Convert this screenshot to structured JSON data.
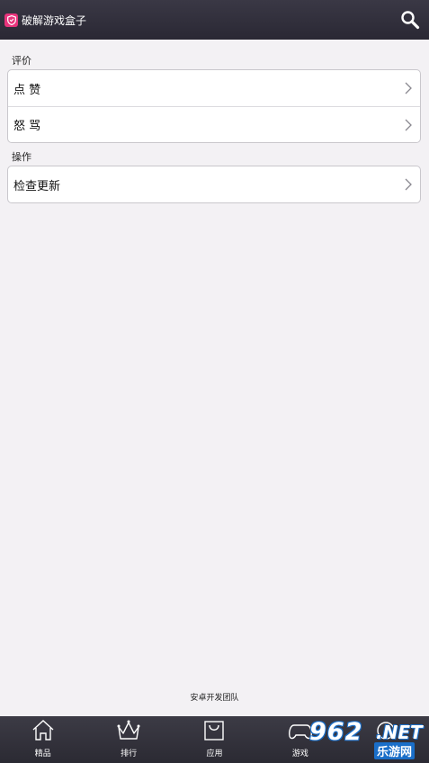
{
  "header": {
    "title": "破解游戏盒子",
    "search_icon": "search-icon",
    "app_icon": "shield-icon"
  },
  "sections": [
    {
      "label": "评价",
      "items": [
        {
          "label": "点 赞"
        },
        {
          "label": "怒 骂"
        }
      ]
    },
    {
      "label": "操作",
      "items": [
        {
          "label": "检查更新"
        }
      ]
    }
  ],
  "footer": {
    "text": "安卓开发团队"
  },
  "bottom_nav": {
    "items": [
      {
        "label": "精品",
        "icon": "home-icon"
      },
      {
        "label": "排行",
        "icon": "crown-icon"
      },
      {
        "label": "应用",
        "icon": "bag-icon"
      },
      {
        "label": "游戏",
        "icon": "gamepad-icon"
      },
      {
        "label": "",
        "icon": "more-icon"
      }
    ]
  },
  "watermark": {
    "num": "962",
    "net": ".NET",
    "cn": "乐游网"
  },
  "colors": {
    "header_bg": "#2f2d39",
    "accent": "#e8347c",
    "page_bg": "#f3f1f4"
  }
}
